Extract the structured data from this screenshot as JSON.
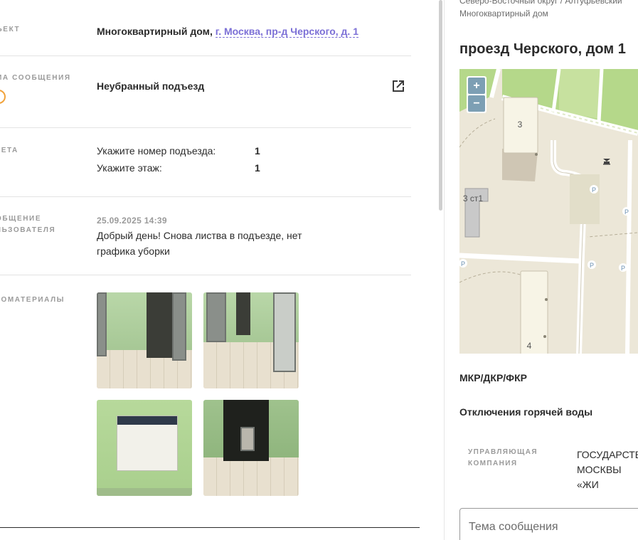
{
  "details": {
    "object_label": "ЪЕКТ",
    "object_type": "Многоквартирный дом, ",
    "object_address": "г. Москва, пр-д Черского, д. 1",
    "topic_label": "МА СООБЩЕНИЯ",
    "topic_value": "Неубранный подъезд",
    "form_label": "КЕТА",
    "form_rows": [
      {
        "q": "Укажите номер подъезда:",
        "a": "1"
      },
      {
        "q": "Укажите этаж:",
        "a": "1"
      }
    ],
    "message_label": "ОБЩЕНИЕ\nЛЬЗОВАТЕЛЯ",
    "message_date": "25.09.2025 14:39",
    "message_text": "Добрый день! Снова листва в подъезде, нет графика уборки",
    "photos_label": "ТОМАТЕРИАЛЫ"
  },
  "sidebar": {
    "breadcrumb_line1": "Северо-Восточный округ / Алтуфьевский",
    "breadcrumb_line2": "Многоквартирный дом",
    "title": "проезд Черского, дом 1",
    "map": {
      "zoom_in": "+",
      "zoom_out": "−",
      "building_labels": [
        "3",
        "3 ст1",
        "4"
      ],
      "parking_label": "P"
    },
    "section_1": "МКР/ДКР/ФКР",
    "section_2": "Отключения горячей воды",
    "uk_label": "УПРАВЛЯЮЩАЯ\nКОМПАНИЯ",
    "uk_value": "ГОСУДАРСТВ\nМОСКВЫ «ЖИ",
    "subject_placeholder": "Тема сообщения"
  },
  "colors": {
    "accent_link": "#7b6fd6",
    "status_ring": "#f1a33c",
    "map_green": "#b5d88a",
    "map_background": "#ece7d8"
  }
}
